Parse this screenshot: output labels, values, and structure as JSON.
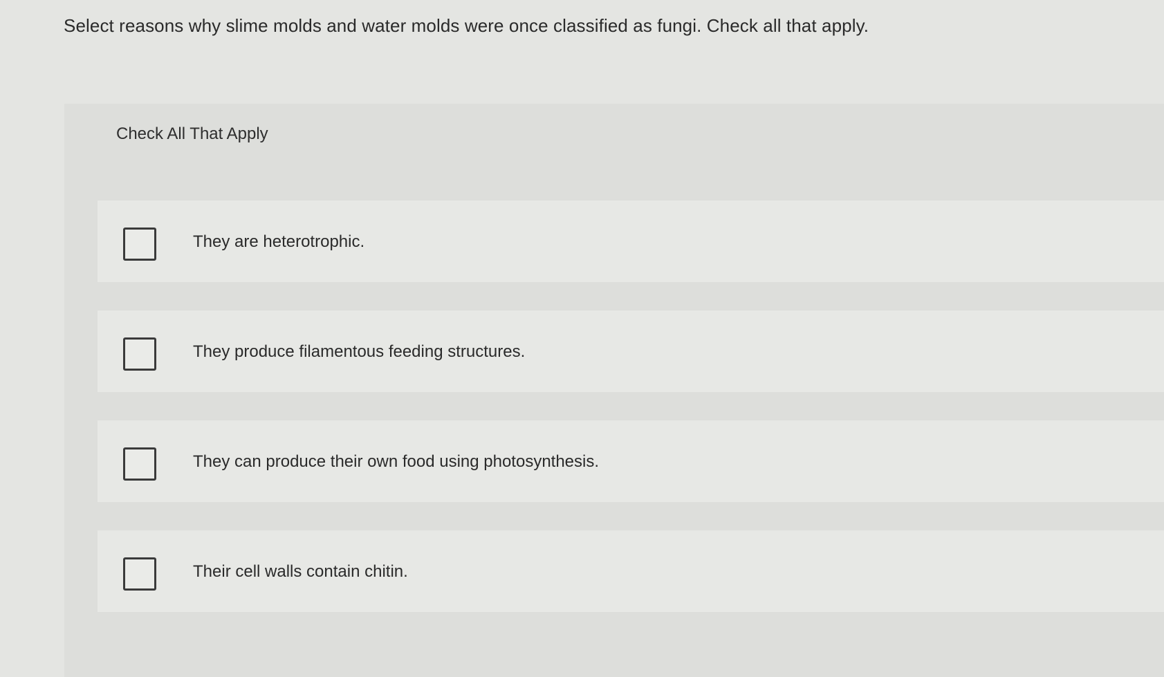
{
  "question": {
    "text": "Select reasons why slime molds and water molds were once classified as fungi. Check all that apply."
  },
  "panel": {
    "label": "Check All That Apply",
    "options": [
      {
        "text": "They are heterotrophic.",
        "checked": false
      },
      {
        "text": "They produce filamentous feeding structures.",
        "checked": false
      },
      {
        "text": "They can produce their own food using photosynthesis.",
        "checked": false
      },
      {
        "text": "Their cell walls contain chitin.",
        "checked": false
      }
    ]
  },
  "colors": {
    "page_background": "#e4e5e2",
    "panel_background": "#dddedb",
    "checkbox_border": "#3a3a3a",
    "text": "#2a2a2a"
  }
}
